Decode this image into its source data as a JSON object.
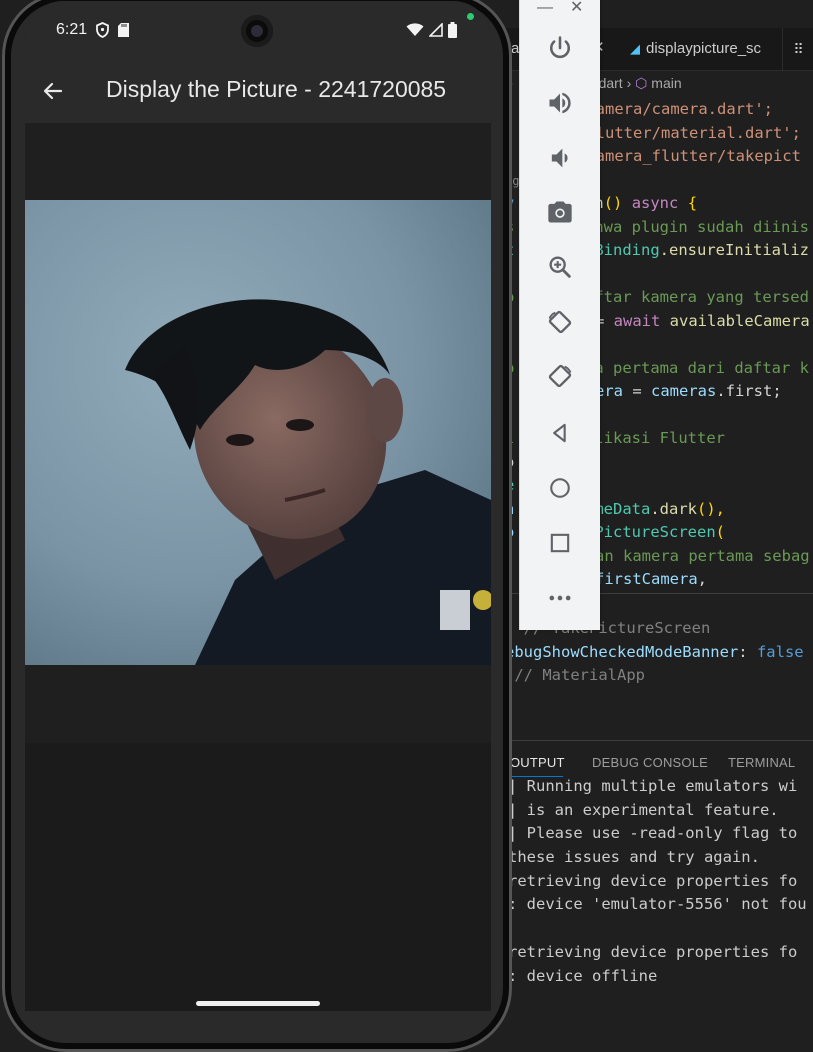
{
  "phone": {
    "status_bar": {
      "time": "6:21"
    },
    "app_bar": {
      "title": "Display the Picture - 2241720085"
    },
    "photo_alt": "Captured photo"
  },
  "emulator_toolbar": {
    "window_minimize": "—",
    "window_close": "✕",
    "buttons": [
      "power",
      "volume-up",
      "volume-down",
      "screenshot",
      "zoom",
      "rotate-left",
      "rotate-right",
      "back",
      "home",
      "overview",
      "more"
    ]
  },
  "editor": {
    "tabs": [
      {
        "label": "ra",
        "active": true
      },
      {
        "label": "displaypicture_sc",
        "active": false
      }
    ],
    "breadcrumb": {
      "file": ".dart",
      "symbol": "main"
    },
    "code_lines": [
      "o",
      "'",
      "'",
      "ugh",
      "v",
      "s",
      "t",
      "",
      "o",
      "",
      "b",
      "",
      "",
      "l",
      "o",
      "e",
      "h",
      "o"
    ],
    "code": {
      "l1": "camera/camera.dart';",
      "l2": "flutter/material.dart';",
      "l3": "kamera_flutter/takepict",
      "l5a": "n",
      "l5b": "() ",
      "l5c": "async",
      "l5d": " {",
      "l6": "hwa plugin sudah diinis",
      "l7a": "Binding",
      "l7b": ".ensureInitializ",
      "l9": "ftar kamera yang tersed",
      "l10a": "= ",
      "l10b": "await",
      "l10c": " availableCamera",
      "l12": "a pertama dari daftar k",
      "l13a": "era",
      "l13b": " = ",
      "l13c": "cameras",
      "l13d": ".first;",
      "l15": "likasi Flutter",
      "l18a": "meData",
      "l18b": ".dark",
      "l18c": "(),",
      "l19a": "PictureScreen",
      "l19b": "(",
      "l20": "an kamera pertama sebag",
      "l21a": "firstCamera",
      "l21b": ","
    },
    "code_after": {
      "l1a": ", ",
      "l1b": "// TakePictureScreen",
      "l2a": "ebugShowCheckedModeBanner",
      "l2b": ": ",
      "l2c": "false",
      "l3": " // MaterialApp"
    },
    "panel": {
      "tabs": [
        "OUTPUT",
        "DEBUG CONSOLE",
        "TERMINAL"
      ],
      "active_tab": "OUTPUT",
      "output_lines": [
        "| Running multiple emulators wi",
        "| is an experimental feature.",
        "| Please use -read-only flag to",
        "these issues and try again.",
        "retrieving device properties fo",
        ": device 'emulator-5556' not fou",
        "",
        "retrieving device properties fo",
        ": device offline"
      ]
    }
  },
  "colors": {
    "editor_bg": "#1f1f1f",
    "toolbar_bg": "#f1f3f4",
    "toolbar_icon": "#5f6368",
    "phone_appbar": "#2a2a2a",
    "accent": "#0078d4"
  }
}
